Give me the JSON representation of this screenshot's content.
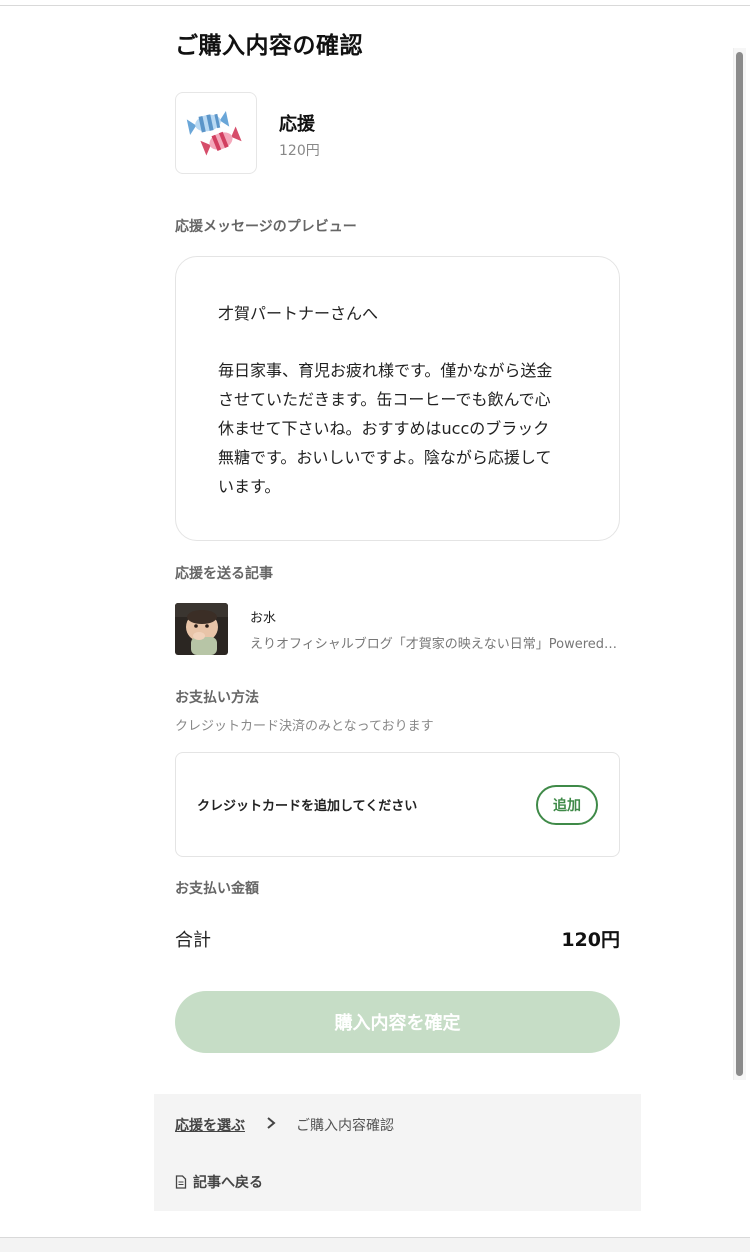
{
  "page": {
    "title": "ご購入内容の確認"
  },
  "product": {
    "name": "応援",
    "price": "120円",
    "icon": "candy-icon"
  },
  "preview": {
    "heading": "応援メッセージのプレビュー",
    "greeting": "才賀パートナーさんへ",
    "body": "毎日家事、育児お疲れ様です。僅かながら送金\nさせていただきます。缶コーヒーでも飲んで心\n休ませて下さいね。おすすめはuccのブラック\n無糖です。おいしいですよ。陰ながら応援して\nいます。"
  },
  "article": {
    "heading": "応援を送る記事",
    "title": "お水",
    "source": "えりオフィシャルブログ「才賀家の映えない日常」Powered by Ameba"
  },
  "payment": {
    "heading": "お支払い方法",
    "note": "クレジットカード決済のみとなっております",
    "card_prompt": "クレジットカードを追加してください",
    "add_label": "追加"
  },
  "amount": {
    "heading": "お支払い金額",
    "total_label": "合計",
    "total_value": "120円"
  },
  "confirm": {
    "label": "購入内容を確定"
  },
  "footer": {
    "breadcrumb_link": "応援を選ぶ",
    "breadcrumb_current": "ご購入内容確認",
    "back_label": "記事へ戻る"
  },
  "colors": {
    "accent": "#3f8a48",
    "confirm_disabled": "#c6ddc6"
  }
}
